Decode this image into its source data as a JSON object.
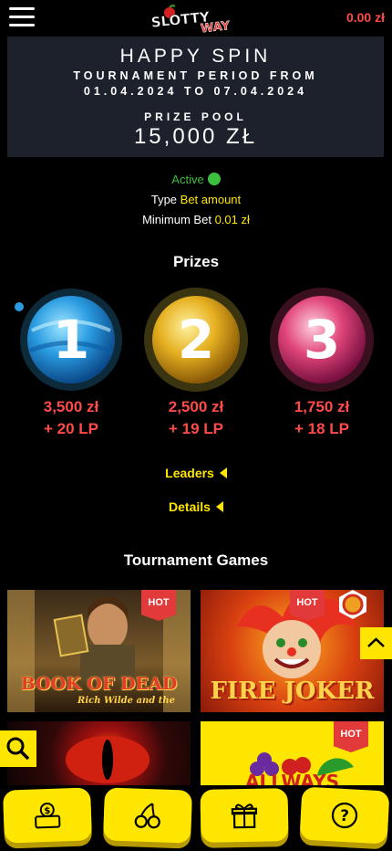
{
  "header": {
    "menu_icon": "hamburger-icon",
    "logo": "Slotty Way",
    "balance": "0.00 zł"
  },
  "tournament": {
    "title": "HAPPY SPIN",
    "period_line1": "TOURNAMENT PERIOD FROM",
    "period_line2": "01.04.2024 TO 07.04.2024",
    "prize_pool_label": "PRIZE POOL",
    "prize_pool": "15,000 ZŁ"
  },
  "status": {
    "active_label": "Active",
    "type_label": "Type",
    "type_value": "Bet amount",
    "min_bet_label": "Minimum Bet",
    "min_bet_value": "0.01 zł"
  },
  "prizes": {
    "title": "Prizes",
    "items": [
      {
        "place": "1",
        "amount": "3,500 zł",
        "points": "+ 20 LP",
        "color": "#2a9be0"
      },
      {
        "place": "2",
        "amount": "2,500 zł",
        "points": "+ 19 LP",
        "color": "#e6b020"
      },
      {
        "place": "3",
        "amount": "1,750 zł",
        "points": "+ 18 LP",
        "color": "#e0457a"
      }
    ]
  },
  "links": {
    "leaders": "Leaders",
    "details": "Details"
  },
  "games": {
    "title": "Tournament Games",
    "hot_label": "HOT",
    "items": [
      {
        "name": "BOOK OF DEAD",
        "subtitle": "Rich Wilde and the",
        "hot": true
      },
      {
        "name": "FIRE JOKER",
        "hot": true
      },
      {
        "name": "",
        "hot": false
      },
      {
        "name": "ALLWAYS",
        "hot": true
      }
    ]
  },
  "bottom_nav": {
    "items": [
      {
        "icon": "cashier-icon"
      },
      {
        "icon": "cherries-icon"
      },
      {
        "icon": "gift-icon"
      },
      {
        "icon": "help-icon"
      }
    ]
  },
  "colors": {
    "accent": "#ffe600",
    "price": "#ff4a4a",
    "active": "#3fbf3f",
    "card_bg": "#1d212b"
  }
}
